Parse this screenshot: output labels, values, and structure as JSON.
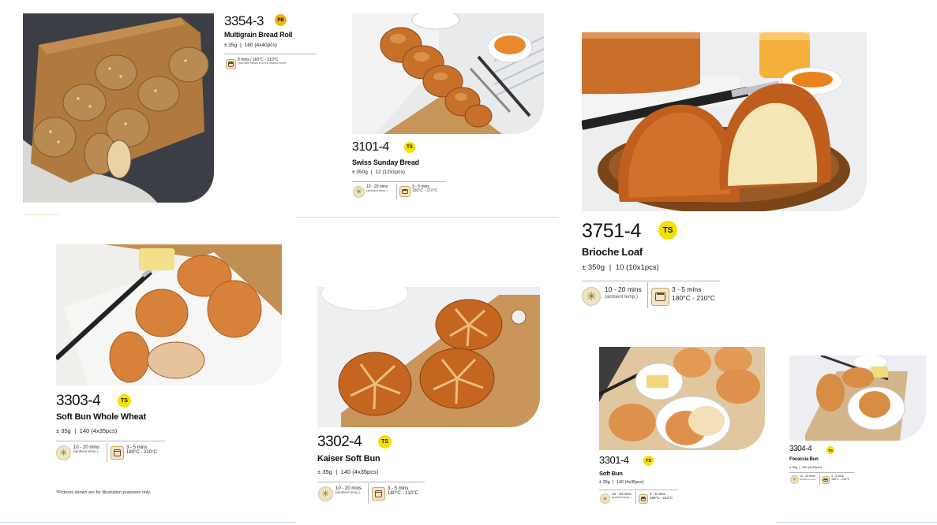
{
  "products": [
    {
      "id": "multigrain",
      "code": "3354-3",
      "badge": "PB",
      "name": "Multigrain Bread Roll",
      "weight": "± 35g",
      "pack": "160 (4x40pcs)",
      "bake": "8 mins  /  160°C - 210°C",
      "bake_note": "(with little steam in a pre-heated oven)"
    },
    {
      "id": "swiss-sunday",
      "code": "3101-4",
      "badge": "TS",
      "name": "Swiss Sunday Bread",
      "weight": "± 350g",
      "pack": "12 (12x1pcs)",
      "thaw": "10 - 20 mins",
      "thaw_note": "(ambient temp.)",
      "bake": "3 - 5 mins",
      "bake_temp": "180°C - 210°C"
    },
    {
      "id": "brioche",
      "code": "3751-4",
      "badge": "TS",
      "name": "Brioche Loaf",
      "weight": "± 350g",
      "pack": "10 (10x1pcs)",
      "thaw": "10 - 20 mins",
      "thaw_note": "(ambient temp.)",
      "bake": "3 - 5 mins",
      "bake_temp": "180°C - 210°C"
    },
    {
      "id": "whole-wheat",
      "code": "3303-4",
      "badge": "TS",
      "name": "Soft Bun Whole Wheat",
      "weight": "± 35g",
      "pack": "140 (4x35pcs)",
      "thaw": "10 - 20 mins",
      "thaw_note": "(ambient temp.)",
      "bake": "3 - 5 mins",
      "bake_temp": "180°C - 210°C"
    },
    {
      "id": "kaiser",
      "code": "3302-4",
      "badge": "TS",
      "name": "Kaiser Soft Bun",
      "weight": "± 35g",
      "pack": "140 (4x35pcs)",
      "thaw": "10 - 20 mins",
      "thaw_note": "(ambient temp.)",
      "bake": "3 - 5 mins",
      "bake_temp": "180°C - 210°C"
    },
    {
      "id": "soft-bun",
      "code": "3301-4",
      "badge": "TS",
      "name": "Soft Bun",
      "weight": "± 35g",
      "pack": "140 (4x35pcs)",
      "thaw": "10 - 20 mins",
      "thaw_note": "(ambient temp.)",
      "bake": "3 - 5 mins",
      "bake_temp": "180°C - 210°C"
    },
    {
      "id": "focaccia",
      "code": "3304-4",
      "badge": "TS",
      "name": "Focaccia Bun",
      "weight": "± 35g",
      "pack": "140 (4x35pcs)",
      "thaw": "10 - 20 mins",
      "thaw_note": "(ambient temp.)",
      "bake": "3 - 5 mins",
      "bake_temp": "180°C - 210°C"
    }
  ],
  "footnote": "*Pictures shown are for illustration purposes only.",
  "colors": {
    "badge_ts": "#f5e000",
    "badge_pb": "#f2b21a",
    "rule": "#bcdcee"
  }
}
